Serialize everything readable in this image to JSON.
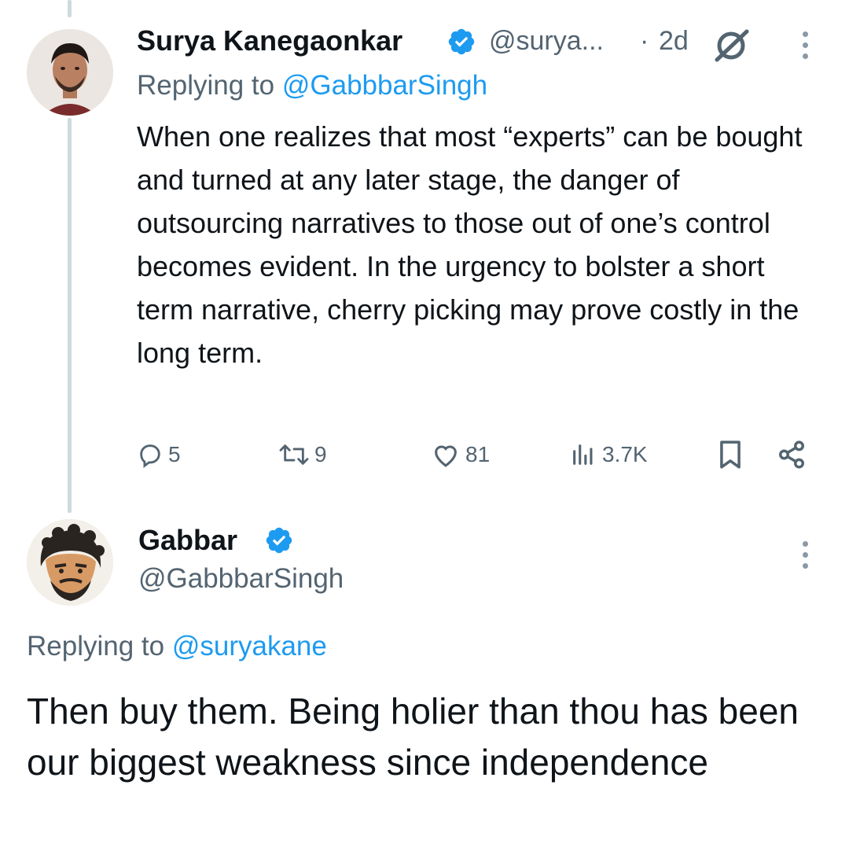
{
  "reply_tweet": {
    "author_name": "Surya Kanegaonkar",
    "handle": "@surya...",
    "separator": "·",
    "time": "2d",
    "replying_prefix": "Replying to",
    "replying_handle": "@GabbbarSingh",
    "body": "When one realizes that most “experts” can be bought and turned at any later stage, the danger of outsourcing narratives to those out of one’s control becomes evident. In the urgency to bolster a short term narrative, cherry picking may prove costly in the long term.",
    "actions": {
      "replies": "5",
      "reposts": "9",
      "likes": "81",
      "views": "3.7K"
    }
  },
  "main_tweet": {
    "author_name": "Gabbar",
    "handle": "@GabbbarSingh",
    "replying_prefix": "Replying to",
    "replying_handle": "@suryakane",
    "body": "Then buy them. Being holier than thou has been our biggest weakness since independence"
  },
  "colors": {
    "accent": "#1d9bf0",
    "text": "#0f1419",
    "muted": "#536471",
    "thread_line": "#cfd9de"
  },
  "icons": [
    "verified-badge-icon",
    "grok-icon",
    "more-icon",
    "reply-icon",
    "repost-icon",
    "like-icon",
    "views-icon",
    "bookmark-icon",
    "share-icon"
  ]
}
